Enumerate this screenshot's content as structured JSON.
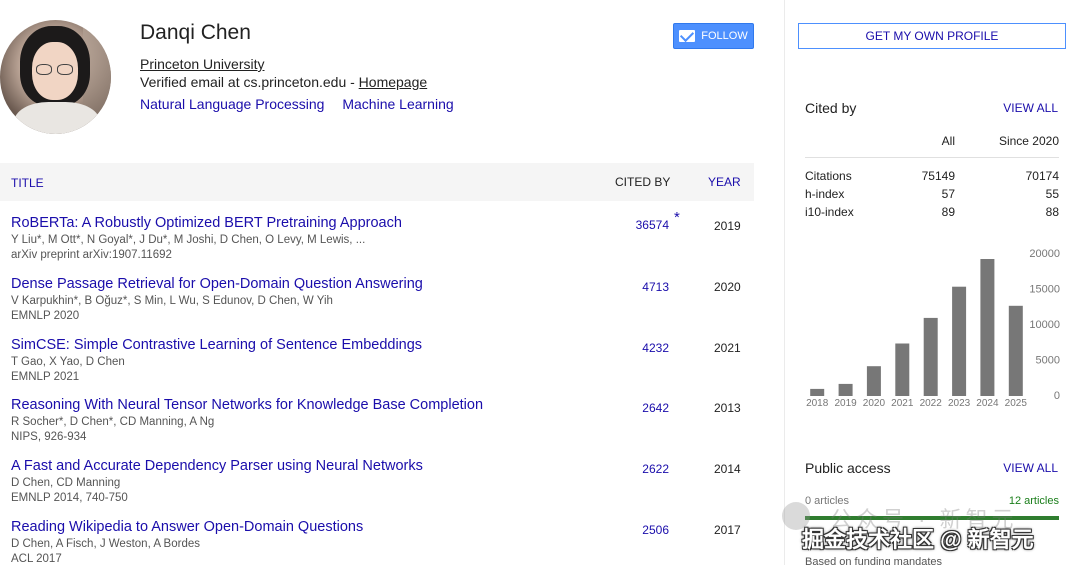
{
  "profile": {
    "name": "Danqi Chen",
    "affiliation": "Princeton University",
    "email_text": "Verified email at cs.princeton.edu - ",
    "homepage_label": "Homepage",
    "interests": [
      "Natural Language Processing",
      "Machine Learning"
    ],
    "follow_label": "FOLLOW"
  },
  "table": {
    "col_title": "TITLE",
    "col_cited": "CITED BY",
    "col_year": "YEAR",
    "rows": [
      {
        "title": "RoBERTa: A Robustly Optimized BERT Pretraining Approach",
        "authors": "Y Liu*, M Ott*, N Goyal*, J Du*, M Joshi, D Chen, O Levy, M Lewis, ...",
        "venue": "arXiv preprint arXiv:1907.11692",
        "cites": "36574",
        "star": "*",
        "year": "2019"
      },
      {
        "title": "Dense Passage Retrieval for Open-Domain Question Answering",
        "authors": "V Karpukhin*, B Oğuz*, S Min, L Wu, S Edunov, D Chen, W Yih",
        "venue": "EMNLP 2020",
        "cites": "4713",
        "star": "",
        "year": "2020"
      },
      {
        "title": "SimCSE: Simple Contrastive Learning of Sentence Embeddings",
        "authors": "T Gao, X Yao, D Chen",
        "venue": "EMNLP 2021",
        "cites": "4232",
        "star": "",
        "year": "2021"
      },
      {
        "title": "Reasoning With Neural Tensor Networks for Knowledge Base Completion",
        "authors": "R Socher*, D Chen*, CD Manning, A Ng",
        "venue": "NIPS, 926-934",
        "cites": "2642",
        "star": "",
        "year": "2013"
      },
      {
        "title": "A Fast and Accurate Dependency Parser using Neural Networks",
        "authors": "D Chen, CD Manning",
        "venue": "EMNLP 2014, 740-750",
        "cites": "2622",
        "star": "",
        "year": "2014"
      },
      {
        "title": "Reading Wikipedia to Answer Open-Domain Questions",
        "authors": "D Chen, A Fisch, J Weston, A Bordes",
        "venue": "ACL 2017",
        "cites": "2506",
        "star": "",
        "year": "2017"
      }
    ]
  },
  "sidebar": {
    "get_profile_label": "GET MY OWN PROFILE",
    "cited_by_title": "Cited by",
    "view_all": "VIEW ALL",
    "stats": {
      "col_all": "All",
      "col_since": "Since 2020",
      "rows": [
        {
          "label": "Citations",
          "all": "75149",
          "since": "70174"
        },
        {
          "label": "h-index",
          "all": "57",
          "since": "55"
        },
        {
          "label": "i10-index",
          "all": "89",
          "since": "88"
        }
      ]
    },
    "public_access_title": "Public access",
    "articles_unavailable": "0 articles",
    "articles_available": "12 articles",
    "funding_note": "Based on funding mandates"
  },
  "chart_data": {
    "type": "bar",
    "categories": [
      "2018",
      "2019",
      "2020",
      "2021",
      "2022",
      "2023",
      "2024",
      "2025"
    ],
    "values": [
      1000,
      1700,
      4200,
      7400,
      11000,
      15400,
      19300,
      12700
    ],
    "yticks": [
      0,
      5000,
      10000,
      15000,
      20000
    ],
    "ylim": [
      0,
      20000
    ],
    "bar_color": "#777777"
  },
  "watermark": {
    "faint": "公众号 · 新智元",
    "main": "掘金技术社区 @ 新智元"
  }
}
